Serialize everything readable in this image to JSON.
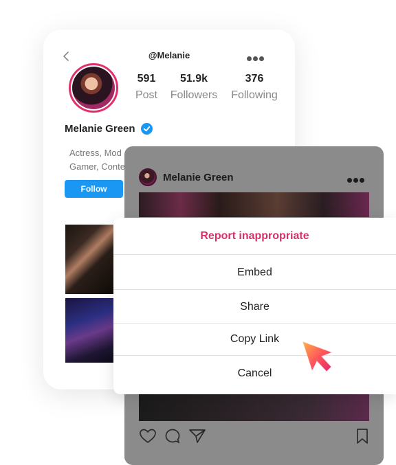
{
  "profile": {
    "handle": "@Melanie",
    "name": "Melanie Green",
    "bio_line1": "Actress, Mod",
    "bio_line2": "Gamer, Conte",
    "follow_label": "Follow",
    "stats": [
      {
        "value": "591",
        "label": "Post"
      },
      {
        "value": "51.9k",
        "label": "Followers"
      },
      {
        "value": "376",
        "label": "Following"
      }
    ]
  },
  "post": {
    "author": "Melanie Green"
  },
  "sheet": {
    "report_label": "Report inappropriate",
    "embed_label": "Embed",
    "share_label": "Share",
    "copy_link_label": "Copy Link",
    "cancel_label": "Cancel"
  },
  "colors": {
    "accent_pink": "#d6326a",
    "follow_blue": "#1a97f3",
    "verified_blue": "#1a97f3"
  },
  "icons": [
    "back-icon",
    "more-icon",
    "verified-icon",
    "heart-icon",
    "comment-icon",
    "send-icon",
    "bookmark-icon",
    "cursor-icon"
  ]
}
